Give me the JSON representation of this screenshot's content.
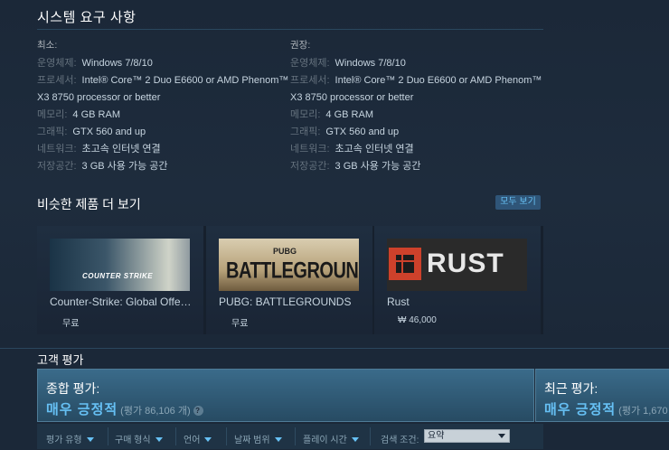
{
  "requirements": {
    "title": "시스템 요구 사항",
    "minimum": {
      "heading": "최소:",
      "rows": [
        {
          "label": "운영체제:",
          "value": "Windows 7/8/10"
        },
        {
          "label": "프로세서:",
          "value": "Intel® Core™ 2 Duo E6600 or AMD Phenom™ X3 8750 processor or better"
        },
        {
          "label": "메모리:",
          "value": "4 GB RAM"
        },
        {
          "label": "그래픽:",
          "value": "GTX 560 and up"
        },
        {
          "label": "네트워크:",
          "value": "초고속 인터넷 연결"
        },
        {
          "label": "저장공간:",
          "value": "3 GB 사용 가능 공간"
        }
      ]
    },
    "recommended": {
      "heading": "권장:",
      "rows": [
        {
          "label": "운영체제:",
          "value": "Windows 7/8/10"
        },
        {
          "label": "프로세서:",
          "value": "Intel® Core™ 2 Duo E6600 or AMD Phenom™ X3 8750 processor or better"
        },
        {
          "label": "메모리:",
          "value": "4 GB RAM"
        },
        {
          "label": "그래픽:",
          "value": "GTX 560 and up"
        },
        {
          "label": "네트워크:",
          "value": "초고속 인터넷 연결"
        },
        {
          "label": "저장공간:",
          "value": "3 GB 사용 가능 공간"
        }
      ]
    }
  },
  "similar": {
    "title": "비슷한 제품 더 보기",
    "see_all": "모두 보기",
    "items": [
      {
        "name": "Counter-Strike: Global Offensive",
        "price": "무료",
        "logo_a": "COUNTER",
        "logo_b": "STRIKE"
      },
      {
        "name": "PUBG: BATTLEGROUNDS",
        "price": "무료",
        "logo_small": "PUBG",
        "logo_big": "BATTLEGROUNDS"
      },
      {
        "name": "Rust",
        "price": "₩ 46,000",
        "logo": "RUST"
      }
    ]
  },
  "reviews": {
    "title": "고객 평가",
    "overall": {
      "label": "종합 평가:",
      "value": "매우 긍정적",
      "count": "(평가 86,106 개)",
      "help": "?"
    },
    "recent": {
      "label": "최근 평가:",
      "value": "매우 긍정적",
      "count": "(평가 1,670"
    },
    "filters": [
      "평가 유형",
      "구매 형식",
      "언어",
      "날짜 범위",
      "플레이 시간"
    ],
    "search_label": "검색 조건:",
    "search_value": "요약"
  },
  "colors": {
    "accent": "#66c0f4",
    "background": "#1b2838",
    "review_panel": "#3a6b8a"
  }
}
